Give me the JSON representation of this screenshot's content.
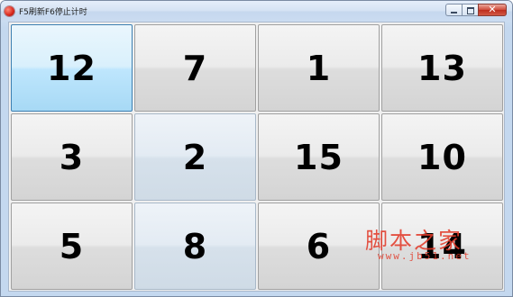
{
  "window": {
    "title": "F5刷新F6停止计时"
  },
  "controls": {
    "close_glyph": "✕"
  },
  "tiles": [
    "12",
    "7",
    "1",
    "13",
    "3",
    "2",
    "15",
    "10",
    "5",
    "8",
    "6",
    "14"
  ],
  "watermark": {
    "text": "脚本之家",
    "url": "www.jb51.net"
  }
}
